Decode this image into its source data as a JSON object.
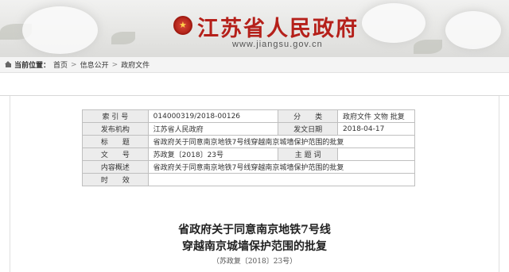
{
  "header": {
    "site_title": "江苏省人民政府",
    "site_url": "www.jiangsu.gov.cn"
  },
  "breadcrumb": {
    "label": "当前位置：",
    "items": [
      "首页",
      "信息公开",
      "政府文件"
    ]
  },
  "meta_table": {
    "rows": [
      {
        "k1": "索 引 号",
        "v1": "014000319/2018-00126",
        "k2": "分　　类",
        "v2": "政府文件 文物 批复"
      },
      {
        "k1": "发布机构",
        "v1": "江苏省人民政府",
        "k2": "发文日期",
        "v2": "2018-04-17"
      },
      {
        "k1": "标　　题",
        "v": "省政府关于同意南京地铁7号线穿越南京城墙保护范围的批复"
      },
      {
        "k1": "文　　号",
        "v1": "苏政复〔2018〕23号",
        "k2": "主 题 词",
        "v2": ""
      },
      {
        "k1": "内容概述",
        "v": "省政府关于同意南京地铁7号线穿越南京城墙保护范围的批复"
      },
      {
        "k1": "时　　效",
        "v": ""
      }
    ]
  },
  "document": {
    "title_line1": "省政府关于同意南京地铁7号线",
    "title_line2": "穿越南京城墙保护范围的批复",
    "doc_number": "（苏政复〔2018〕23号）"
  },
  "colors": {
    "brand_red": "#b5201a",
    "table_header_bg": "#ececec"
  }
}
